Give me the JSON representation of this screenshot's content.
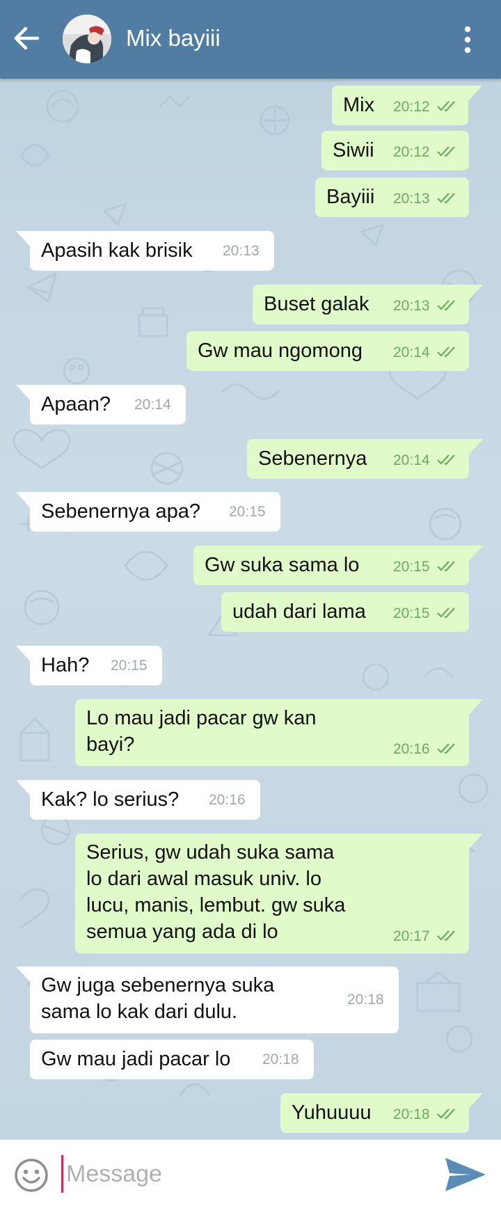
{
  "header": {
    "title": "Mix bayiii",
    "back_icon": "arrow-left-icon",
    "menu_icon": "kebab-menu-icon",
    "color": "#517da2"
  },
  "messages": [
    {
      "dir": "out",
      "text": "Mix",
      "time": "20:12"
    },
    {
      "dir": "out",
      "text": "Siwii",
      "time": "20:12"
    },
    {
      "dir": "out",
      "text": "Bayiii",
      "time": "20:13"
    },
    {
      "dir": "in",
      "text": "Apasih kak brisik",
      "time": "20:13"
    },
    {
      "dir": "out",
      "text": "Buset galak",
      "time": "20:13"
    },
    {
      "dir": "out",
      "text": "Gw mau ngomong",
      "time": "20:14"
    },
    {
      "dir": "in",
      "text": "Apaan?",
      "time": "20:14"
    },
    {
      "dir": "out",
      "text": "Sebenernya",
      "time": "20:14"
    },
    {
      "dir": "in",
      "text": "Sebenernya apa?",
      "time": "20:15"
    },
    {
      "dir": "out",
      "text": "Gw suka sama lo",
      "time": "20:15"
    },
    {
      "dir": "out",
      "text": "udah dari lama",
      "time": "20:15"
    },
    {
      "dir": "in",
      "text": "Hah?",
      "time": "20:15"
    },
    {
      "dir": "out",
      "lines": [
        "Lo mau jadi pacar gw kan",
        "bayi?"
      ],
      "time": "20:16"
    },
    {
      "dir": "in",
      "text": "Kak? lo serius?",
      "time": "20:16"
    },
    {
      "dir": "out",
      "lines": [
        "Serius, gw udah suka sama",
        "lo dari awal masuk univ. lo",
        "lucu, manis, lembut. gw suka",
        "semua yang ada di lo"
      ],
      "time": "20:17"
    },
    {
      "dir": "in",
      "lines": [
        "Gw juga sebenernya suka",
        "sama lo kak dari dulu."
      ],
      "time": "20:18"
    },
    {
      "dir": "in",
      "text": "Gw mau jadi pacar lo",
      "time": "20:18"
    },
    {
      "dir": "out",
      "text": "Yuhuuuu",
      "time": "20:18"
    }
  ],
  "composer": {
    "placeholder": "Message",
    "emoji_icon": "smiley-icon",
    "send_icon": "send-icon"
  },
  "colors": {
    "outgoing_bubble": "#e0fbc9",
    "incoming_bubble": "#ffffff",
    "read_ticks": "#6aab5e",
    "send_button": "#5b8cb7"
  }
}
